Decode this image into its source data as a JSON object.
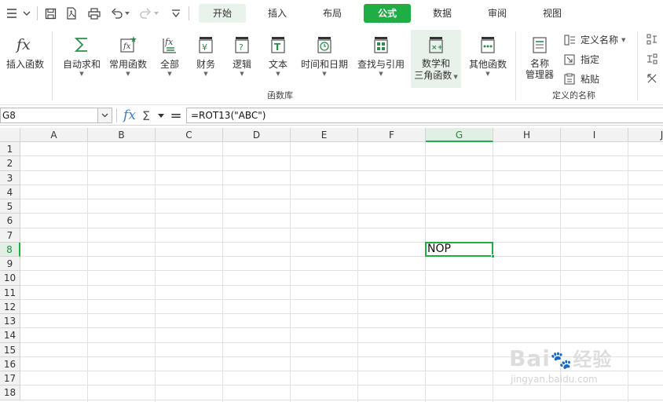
{
  "tabs": [
    {
      "label": "开始"
    },
    {
      "label": "插入"
    },
    {
      "label": "布局"
    },
    {
      "label": "公式"
    },
    {
      "label": "数据"
    },
    {
      "label": "审阅"
    },
    {
      "label": "视图"
    }
  ],
  "active_tab": "公式",
  "ribbon": {
    "buttons": [
      {
        "label": "插入函数"
      },
      {
        "label": "自动求和"
      },
      {
        "label": "常用函数"
      },
      {
        "label": "全部"
      },
      {
        "label": "财务"
      },
      {
        "label": "逻辑"
      },
      {
        "label": "文本"
      },
      {
        "label": "时间和日期"
      },
      {
        "label": "查找与引用"
      },
      {
        "label": "数学和"
      },
      {
        "label": "三角函数"
      },
      {
        "label": "其他函数"
      },
      {
        "label": "名称"
      },
      {
        "label": "管理器"
      }
    ],
    "small_buttons": [
      {
        "label": "定义名称"
      },
      {
        "label": "指定"
      },
      {
        "label": "粘贴"
      }
    ],
    "group_labels": [
      "函数库",
      "定义的名称"
    ]
  },
  "formula_bar": {
    "name_box": "G8",
    "fx_symbol": "fx",
    "sum_symbol": "Σ",
    "equals_symbol": "=",
    "formula": "=ROT13(\"ABC\")"
  },
  "grid": {
    "columns": [
      "A",
      "B",
      "C",
      "D",
      "E",
      "F",
      "G",
      "H",
      "I",
      "J"
    ],
    "rows": [
      "1",
      "2",
      "3",
      "4",
      "5",
      "6",
      "7",
      "8",
      "9",
      "10",
      "11",
      "12",
      "13",
      "14",
      "15",
      "16",
      "17",
      "18"
    ],
    "selected_column": "G",
    "selected_row": "8",
    "active_cell_value": "NOP"
  },
  "watermark": {
    "brand": "Bai",
    "brand_cn": "经验",
    "url": "jingyan.baidu.com"
  },
  "colors": {
    "accent": "#1fad46",
    "header_bg": "#f2f2f2",
    "grid_line": "#e1e1e1"
  }
}
